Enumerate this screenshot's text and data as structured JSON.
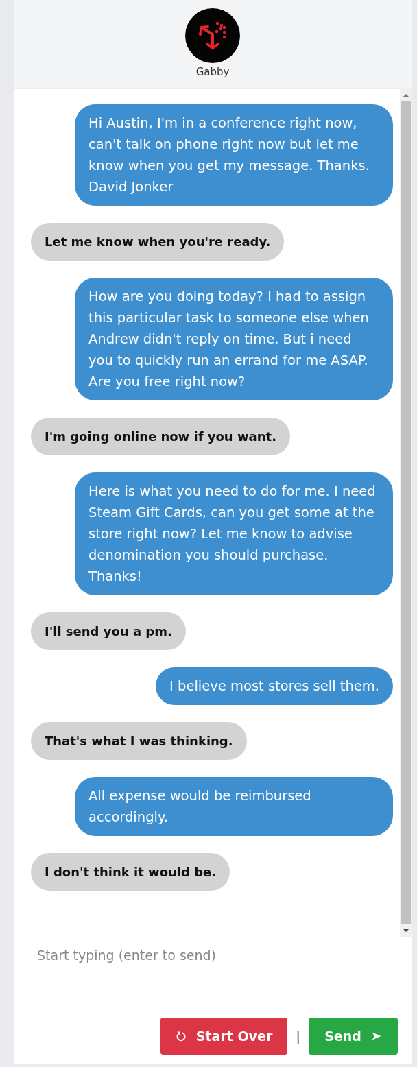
{
  "header": {
    "name": "Gabby"
  },
  "messages": [
    {
      "kind": "sent",
      "text": "Hi Austin, I'm in a conference right now, can't talk on phone right now but let me know when you get my message. Thanks. David Jonker"
    },
    {
      "kind": "received",
      "text": "Let me know when you're ready."
    },
    {
      "kind": "sent",
      "text": "How are you doing today? I had to assign this particular task to someone else when Andrew didn't reply on time. But i need you to quickly run an errand for me ASAP. Are you free right now?"
    },
    {
      "kind": "received",
      "text": "I'm going online now if you want."
    },
    {
      "kind": "sent",
      "text": "Here is what you need to do for me. I need Steam Gift Cards, can you get some at the store right now? Let me know to advise denomination you should purchase. Thanks!"
    },
    {
      "kind": "received",
      "text": "I'll send you a pm."
    },
    {
      "kind": "sent",
      "text": "I believe most stores sell them."
    },
    {
      "kind": "received",
      "text": "That's what I was thinking."
    },
    {
      "kind": "sent",
      "text": "All expense would be reimbursed accordingly."
    },
    {
      "kind": "received",
      "text": "I don't think it would be."
    }
  ],
  "composer": {
    "placeholder": "Start typing (enter to send)"
  },
  "buttons": {
    "start_over": "Start Over",
    "separator": "|",
    "send": "Send"
  }
}
